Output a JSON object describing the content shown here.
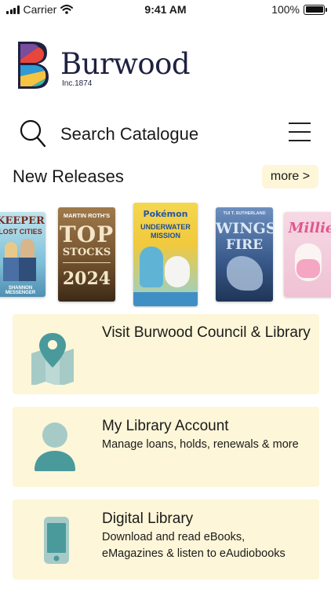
{
  "status_bar": {
    "carrier": "Carrier",
    "time": "9:41 AM",
    "battery": "100%"
  },
  "header": {
    "brand_name": "Burwood",
    "brand_inc": "Inc.1874",
    "logo_colors": [
      "#e8463c",
      "#f6c443",
      "#2e9bd6",
      "#3fb6a8",
      "#7a4d9c",
      "#1e2140"
    ]
  },
  "search": {
    "placeholder": "Search Catalogue"
  },
  "new_releases": {
    "title": "New Releases",
    "more_label": "more >",
    "books": [
      {
        "title_lines": [
          "KEEPER",
          "LOST CITIES"
        ],
        "author": "SHANNON MESSENGER",
        "color": "#5fa7c9"
      },
      {
        "title_lines": [
          "TOP",
          "STOCKS",
          "2024"
        ],
        "author": "MARTIN ROTH'S",
        "color": "#7a5a35"
      },
      {
        "title_lines": [
          "UNDERWATER",
          "MISSION"
        ],
        "author": "Pokémon",
        "color": "#f1d34a"
      },
      {
        "title_lines": [
          "WINGS",
          "FIRE"
        ],
        "author": "TUI T. SUTHERLAND",
        "color": "#3c5d8a"
      },
      {
        "title_lines": [
          "Millie"
        ],
        "author": "",
        "color": "#f0c7d6"
      }
    ]
  },
  "cards": [
    {
      "title": "Visit Burwood Council & Library",
      "subtitle_lines": [],
      "icon": "map-pin-icon"
    },
    {
      "title": "My Library Account",
      "subtitle_lines": [
        "Manage loans, holds, renewals & more"
      ],
      "icon": "person-icon"
    },
    {
      "title": "Digital Library",
      "subtitle_lines": [
        "Download and read eBooks,",
        "eMagazines & listen to eAudiobooks"
      ],
      "icon": "phone-icon"
    }
  ],
  "accent_color": "#4a9a9c",
  "card_background": "#fdf6d8"
}
